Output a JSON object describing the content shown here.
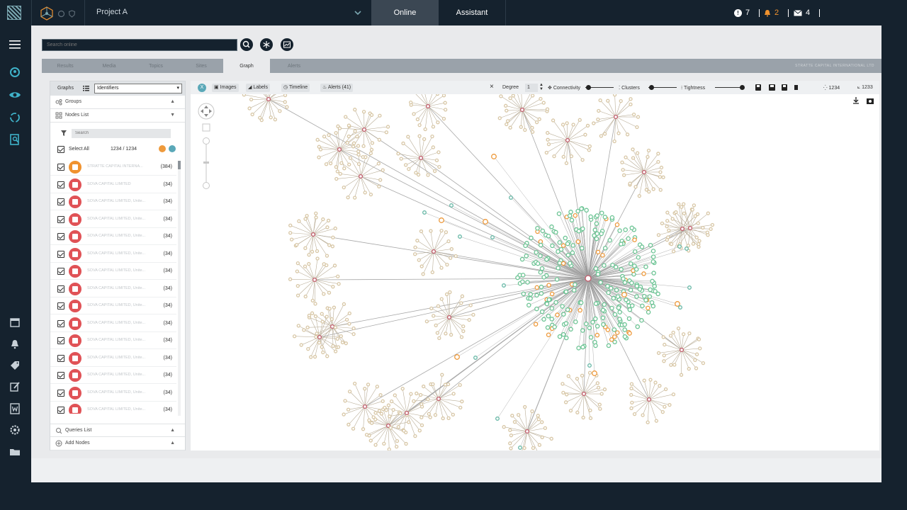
{
  "app": {
    "project": "Project A",
    "tabs": [
      {
        "label": "Online",
        "active": true
      },
      {
        "label": "Assistant",
        "active": false
      }
    ],
    "status": {
      "info_count": "7",
      "alert_count": "2",
      "message_count": "4"
    }
  },
  "leftbar": {
    "icons": [
      "menu-icon",
      "user-icon",
      "eye-icon",
      "refresh-icon",
      "search-doc-icon",
      "calendar-icon",
      "bell-icon",
      "tag-icon",
      "edit-icon",
      "word-doc-icon",
      "gear-icon",
      "folder-icon"
    ]
  },
  "search": {
    "placeholder": "Search online"
  },
  "subtabs": [
    {
      "label": "Results",
      "active": false
    },
    {
      "label": "Media",
      "active": false
    },
    {
      "label": "Topics",
      "active": false
    },
    {
      "label": "Sites",
      "active": false
    },
    {
      "label": "Graph",
      "active": true
    },
    {
      "label": "Alerts",
      "active": false
    }
  ],
  "company_label": "STRATTE CAPITAL INTERNATIONAL LTD",
  "panel": {
    "graphs_label": "Graphs",
    "selector_value": "Identifiers",
    "groups": "Groups",
    "nodes_list": "Nodes List",
    "node_search_placeholder": "Search",
    "select_all": "Select All",
    "select_count": "1234 / 1234",
    "queries_list": "Queries List",
    "add_nodes": "Add Nodes",
    "rows": [
      {
        "name": "STRATTE CAPITAL INTERNA...",
        "count": "(384)",
        "color": "#f0922e"
      },
      {
        "name": "SOVA CAPITAL LIMITED",
        "count": "(34)",
        "color": "#e05256"
      },
      {
        "name": "SOVA CAPITAL LIMITED, Unite...",
        "count": "(34)",
        "color": "#e05256"
      },
      {
        "name": "SOVA CAPITAL LIMITED, Unite...",
        "count": "(34)",
        "color": "#e05256"
      },
      {
        "name": "SOVA CAPITAL LIMITED, Unite...",
        "count": "(34)",
        "color": "#e05256"
      },
      {
        "name": "SOVA CAPITAL LIMITED, Unite...",
        "count": "(34)",
        "color": "#e05256"
      },
      {
        "name": "SOVA CAPITAL LIMITED, Unite...",
        "count": "(34)",
        "color": "#e05256"
      },
      {
        "name": "SOVA CAPITAL LIMITED, Unite...",
        "count": "(34)",
        "color": "#e05256"
      },
      {
        "name": "SOVA CAPITAL LIMITED, Unite...",
        "count": "(34)",
        "color": "#e05256"
      },
      {
        "name": "SOVA CAPITAL LIMITED, Unite...",
        "count": "(34)",
        "color": "#e05256"
      },
      {
        "name": "SOVA CAPITAL LIMITED, Unite...",
        "count": "(34)",
        "color": "#e05256"
      },
      {
        "name": "SOVA CAPITAL LIMITED, Unite...",
        "count": "(34)",
        "color": "#e05256"
      },
      {
        "name": "SOVA CAPITAL LIMITED, Unite...",
        "count": "(34)",
        "color": "#e05256"
      },
      {
        "name": "SOVA CAPITAL LIMITED, Unite...",
        "count": "(34)",
        "color": "#e05256"
      },
      {
        "name": "SOVA CAPITAL LIMITED, Unite...",
        "count": "(34)",
        "color": "#e05256"
      }
    ]
  },
  "graph_toolbar": {
    "images": "Images",
    "labels": "Labels",
    "timeline": "Timeline",
    "alerts": "Alerts (41)",
    "degree_label": "Degree",
    "degree_value": "1",
    "connectivity": "Connectivity",
    "clusters": "Clusters",
    "tightness": "Tightness",
    "nodes_count": "1234",
    "edges_count": "1233"
  },
  "colors": {
    "accent": "#1b2a38",
    "node_green": "#6cc494",
    "node_tan": "#d8c7a6",
    "node_orange": "#ee9a3c",
    "node_teal": "#67b8a6"
  }
}
